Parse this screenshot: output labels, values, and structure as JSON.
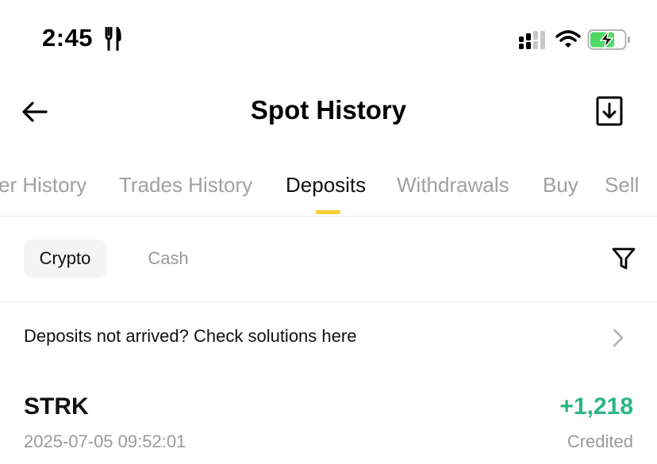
{
  "status_bar": {
    "time": "2:45",
    "icons": [
      "fork-knife-icon",
      "signal-icon",
      "wifi-icon",
      "battery-charging-icon"
    ],
    "battery_color": "#4cd964"
  },
  "header": {
    "title": "Spot History",
    "back_icon": "arrow-left-icon",
    "download_icon": "download-icon"
  },
  "tabs": {
    "items": [
      {
        "label": "er History",
        "active": false
      },
      {
        "label": "Trades History",
        "active": false
      },
      {
        "label": "Deposits",
        "active": true
      },
      {
        "label": "Withdrawals",
        "active": false
      },
      {
        "label": "Buy",
        "active": false
      },
      {
        "label": "Sell",
        "active": false
      }
    ],
    "accent_color": "#f6d036"
  },
  "filters": {
    "chips": [
      {
        "label": "Crypto",
        "active": true
      },
      {
        "label": "Cash",
        "active": false
      }
    ],
    "filter_icon": "funnel-icon"
  },
  "notice": {
    "text": "Deposits not arrived? Check solutions here",
    "icon": "chevron-right-icon"
  },
  "records": [
    {
      "coin": "STRK",
      "amount": "+1,218",
      "date": "2025-07-05 09:52:01",
      "status": "Credited",
      "amount_color": "#2bb682"
    }
  ]
}
